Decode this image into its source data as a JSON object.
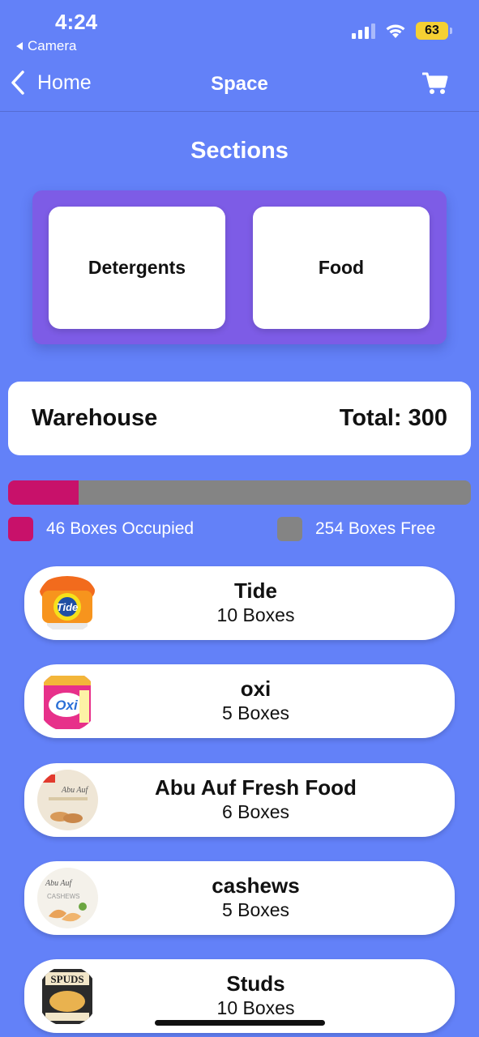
{
  "status_bar": {
    "time": "4:24",
    "back_app": "Camera",
    "battery": "63",
    "icons": [
      "signal-icon",
      "wifi-icon",
      "battery-icon"
    ]
  },
  "nav": {
    "back_label": "Home",
    "title": "Space",
    "icons": [
      "chevron-left-icon",
      "cart-icon"
    ]
  },
  "sections": {
    "title": "Sections",
    "items": [
      {
        "label": "Detergents"
      },
      {
        "label": "Food"
      }
    ]
  },
  "warehouse": {
    "label": "Warehouse",
    "total": "Total: 300",
    "occupied_fraction": 0.153
  },
  "legend": {
    "occupied": "46 Boxes Occupied",
    "free": "254 Boxes Free"
  },
  "products": [
    {
      "name": "Tide",
      "quantity": "10 Boxes",
      "icon": "tide-pods-image"
    },
    {
      "name": "oxi",
      "quantity": "5 Boxes",
      "icon": "oxi-detergent-image"
    },
    {
      "name": "Abu Auf Fresh Food",
      "quantity": "6 Boxes",
      "icon": "abu-auf-food-image"
    },
    {
      "name": "cashews",
      "quantity": "5 Boxes",
      "icon": "cashews-image"
    },
    {
      "name": "Studs",
      "quantity": "10 Boxes",
      "icon": "spuds-chips-image"
    }
  ],
  "colors": {
    "background": "#6381F8",
    "panel": "#7D5CE6",
    "occupied": "#C8116A",
    "free": "#848484"
  }
}
